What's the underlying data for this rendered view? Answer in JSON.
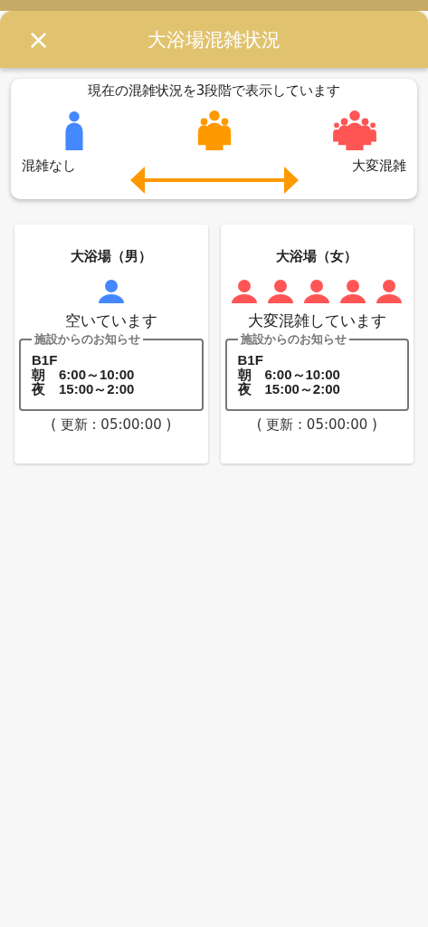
{
  "header": {
    "close": "×",
    "title": "大浴場混雑状況"
  },
  "legend": {
    "caption": "現在の混雑状況を3段階で表示しています",
    "levels": [
      {
        "kind": "one",
        "color": "#4488ff"
      },
      {
        "kind": "group",
        "color": "#ff9900"
      },
      {
        "kind": "crowd",
        "color": "#ff5555"
      }
    ],
    "low_label": "混雑なし",
    "high_label": "大変混雑"
  },
  "baths": [
    {
      "title": "大浴場（男）",
      "people": [
        {
          "color": "#4488ff"
        }
      ],
      "status": "空いています",
      "notice_title": "施設からのお知らせ",
      "notice_lines": [
        "B1F",
        "朝　6:00～10:00",
        "夜　15:00～2:00"
      ],
      "updated": "( 更新 : 05:00:00 )"
    },
    {
      "title": "大浴場（女）",
      "people": [
        {
          "color": "#ff5555"
        },
        {
          "color": "#ff5555"
        },
        {
          "color": "#ff5555"
        },
        {
          "color": "#ff5555"
        },
        {
          "color": "#ff5555"
        }
      ],
      "status": "大変混雑しています",
      "notice_title": "施設からのお知らせ",
      "notice_lines": [
        "B1F",
        "朝　6:00～10:00",
        "夜　15:00～2:00"
      ],
      "updated": "( 更新 : 05:00:00 )"
    }
  ]
}
